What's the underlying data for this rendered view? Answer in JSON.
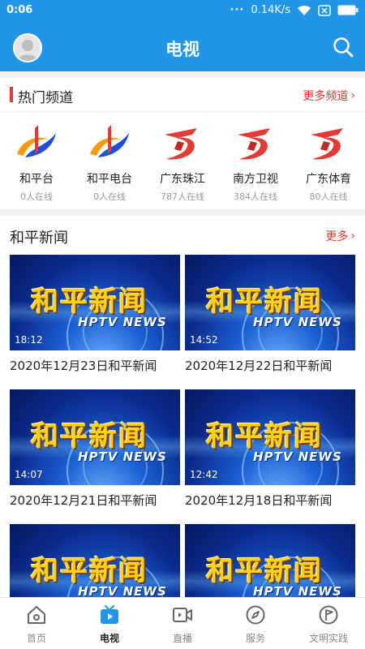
{
  "status": {
    "time": "0:06",
    "speed": "0.14K/s"
  },
  "header": {
    "title": "电视"
  },
  "hot": {
    "title": "热门频道",
    "more_label": "更多频道",
    "channels": [
      {
        "name": "和平台",
        "online": "0人在线",
        "logo": "heping"
      },
      {
        "name": "和平电台",
        "online": "0人在线",
        "logo": "heping"
      },
      {
        "name": "广东珠江",
        "online": "787人在线",
        "logo": "guangdong"
      },
      {
        "name": "南方卫视",
        "online": "384人在线",
        "logo": "guangdong"
      },
      {
        "name": "广东体育",
        "online": "80人在线",
        "logo": "guangdong"
      }
    ]
  },
  "news": {
    "title": "和平新闻",
    "more_label": "更多",
    "thumb_logo_cn": "和平新闻",
    "thumb_logo_en": "HPTV NEWS",
    "items": [
      {
        "duration": "18:12",
        "title": "2020年12月23日和平新闻"
      },
      {
        "duration": "14:52",
        "title": "2020年12月22日和平新闻"
      },
      {
        "duration": "14:07",
        "title": "2020年12月21日和平新闻"
      },
      {
        "duration": "12:42",
        "title": "2020年12月18日和平新闻"
      },
      {
        "duration": "",
        "title": ""
      },
      {
        "duration": "",
        "title": ""
      }
    ]
  },
  "tabs": [
    {
      "label": "首页",
      "icon": "home-icon",
      "active": false
    },
    {
      "label": "电视",
      "icon": "tv-icon",
      "active": true
    },
    {
      "label": "直播",
      "icon": "live-video-icon",
      "active": false
    },
    {
      "label": "服务",
      "icon": "compass-icon",
      "active": false
    },
    {
      "label": "文明实践",
      "icon": "flag-circle-icon",
      "active": false
    }
  ],
  "colors": {
    "brand_blue": "#2196e8",
    "accent_red": "#e53935",
    "tab_active": "#2196e8"
  }
}
